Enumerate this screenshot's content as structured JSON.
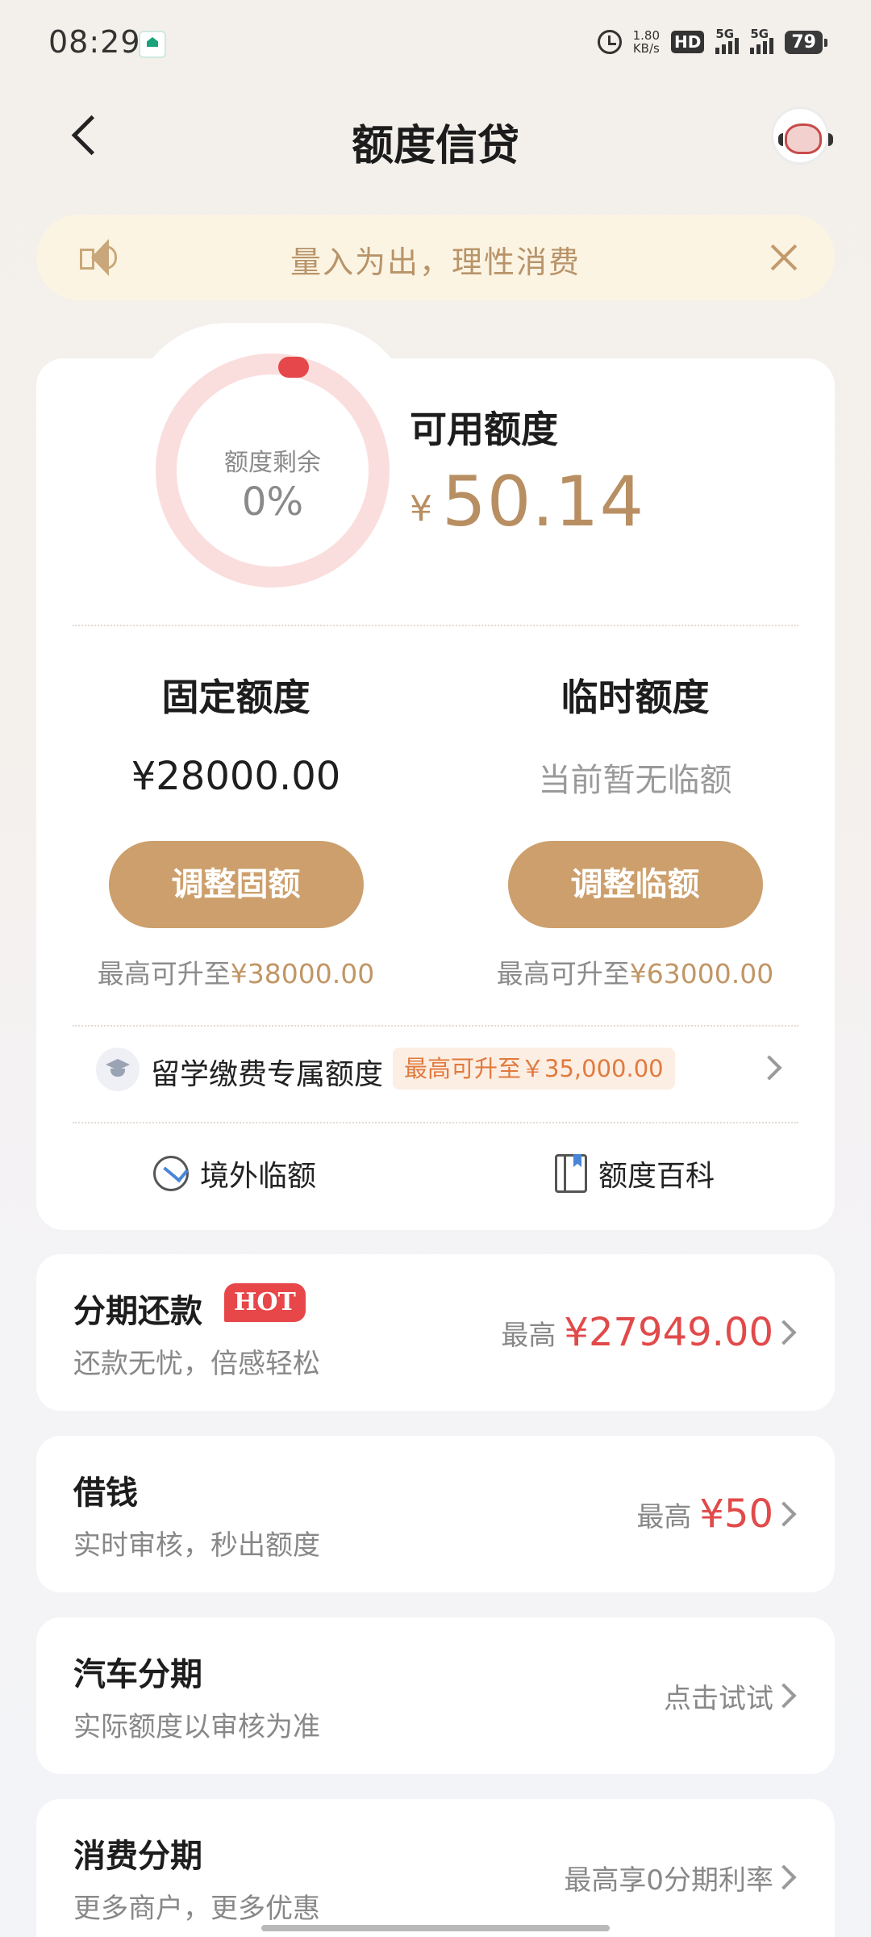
{
  "status_bar": {
    "time": "08:29",
    "net_speed_value": "1.80",
    "net_speed_unit": "KB/s",
    "hd_label": "HD",
    "signal_1": "5G",
    "signal_2": "5G",
    "battery": "79"
  },
  "header": {
    "title": "额度信贷"
  },
  "notice": {
    "text": "量入为出，理性消费"
  },
  "quota": {
    "gauge_label": "额度剩余",
    "gauge_value": "0%",
    "gauge_fraction": 0,
    "available_label": "可用额度",
    "available_currency": "¥",
    "available_amount": "50.14",
    "fixed": {
      "title": "固定额度",
      "value": "¥28000.00",
      "button": "调整固额",
      "note_prefix": "最高可升至",
      "note_amount": "¥38000.00"
    },
    "temp": {
      "title": "临时额度",
      "value": "当前暂无临额",
      "button": "调整临额",
      "note_prefix": "最高可升至",
      "note_amount": "¥63000.00"
    },
    "study": {
      "label": "留学缴费专属额度",
      "badge": "最高可升至￥35,000.00"
    },
    "tools": [
      {
        "label": "境外临额",
        "icon": "plane-globe-icon"
      },
      {
        "label": "额度百科",
        "icon": "book-icon"
      }
    ]
  },
  "products": [
    {
      "name": "分期还款",
      "badge": "HOT",
      "sub": "还款无忧，倍感轻松",
      "prefix": "最高",
      "amount": "¥27949.00"
    },
    {
      "name": "借钱",
      "sub": "实时审核，秒出额度",
      "prefix": "最高",
      "amount": "¥50"
    },
    {
      "name": "汽车分期",
      "sub": "实际额度以审核为准",
      "hint": "点击试试"
    },
    {
      "name": "消费分期",
      "sub": "更多商户，更多优惠",
      "hint": "最高享0分期利率"
    }
  ],
  "colors": {
    "accent_gold": "#cc9f6c",
    "amount_gold": "#b88f62",
    "amount_red": "#e14a4a",
    "hot_red": "#e8474a",
    "notice_bg": "#fcf4e3"
  }
}
